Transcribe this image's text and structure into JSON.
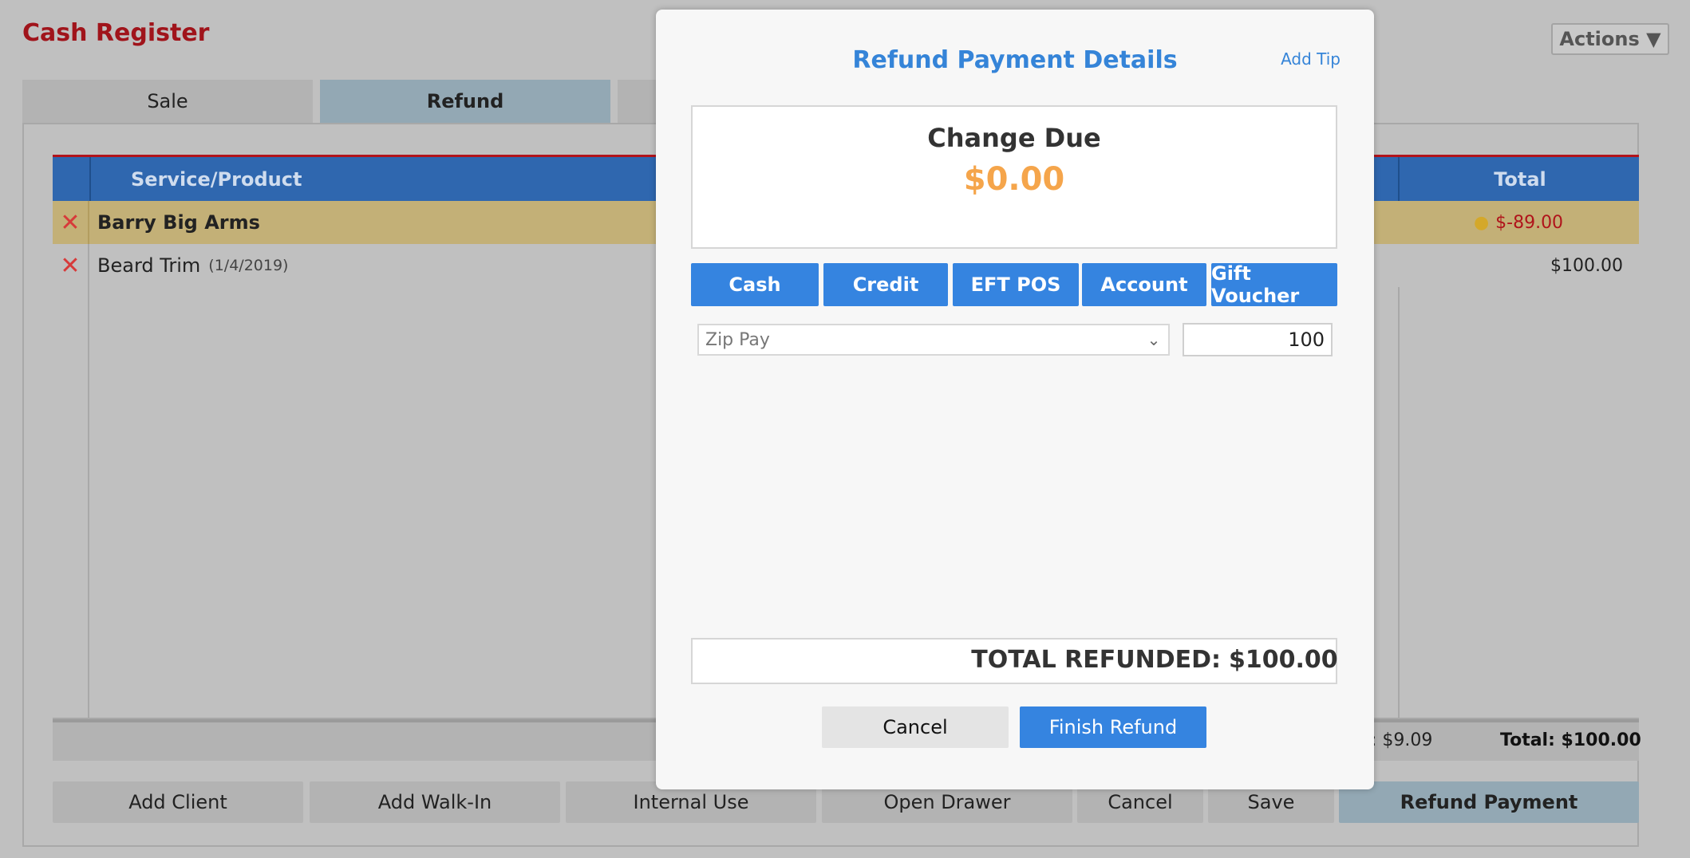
{
  "page": {
    "title": "Cash Register",
    "actions_label": "Actions ▼"
  },
  "tabs": {
    "sale": "Sale",
    "refund": "Refund"
  },
  "table": {
    "headers": {
      "service_product": "Service/Product",
      "total": "Total"
    },
    "client_row": {
      "name": "Barry Big Arms",
      "total": "$-89.00"
    },
    "item_row": {
      "name": "Beard Trim",
      "date": "(1/4/2019)",
      "total": "$100.00"
    }
  },
  "footer": {
    "tax": "x: $9.09",
    "total": "Total: $100.00"
  },
  "bottom_buttons": {
    "add_client": "Add Client",
    "add_walk_in": "Add Walk-In",
    "internal_use": "Internal Use",
    "open_drawer": "Open Drawer",
    "cancel": "Cancel",
    "save": "Save",
    "refund_payment": "Refund Payment"
  },
  "modal": {
    "title": "Refund Payment Details",
    "add_tip": "Add Tip",
    "change_due_label": "Change Due",
    "change_due_value": "$0.00",
    "payment_methods": [
      "Cash",
      "Credit",
      "EFT POS",
      "Account",
      "Gift Voucher"
    ],
    "selected_method": "Zip Pay",
    "amount_value": "100",
    "total_refunded_label": "TOTAL REFUNDED:",
    "total_refunded_value": "$100.00",
    "cancel_label": "Cancel",
    "finish_label": "Finish Refund"
  },
  "colors": {
    "title_red": "#a0141b",
    "header_blue": "#2f67af",
    "client_row_gold": "#c3b077",
    "modal_accent": "#3584e0",
    "change_due_orange": "#f5a54b",
    "negative_red": "#b0141b"
  },
  "icons": {
    "remove": "x-icon",
    "coins": "coins-icon",
    "dropdown": "chevron-down-icon"
  }
}
